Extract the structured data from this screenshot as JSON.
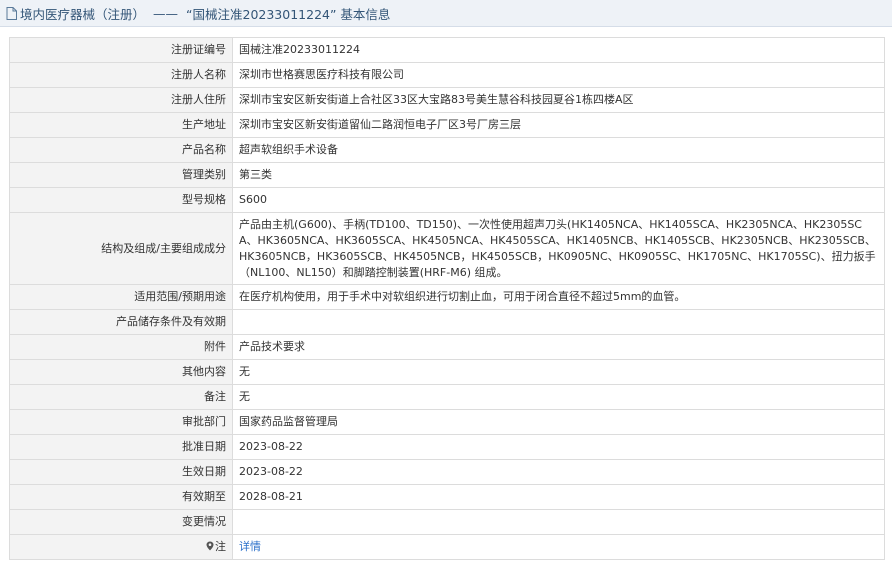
{
  "header": {
    "section": "境内医疗器械（注册）",
    "separator": "——",
    "title": "“国械注准20233011224” 基本信息"
  },
  "rows": [
    {
      "label": "注册证编号",
      "value": "国械注准20233011224"
    },
    {
      "label": "注册人名称",
      "value": "深圳市世格赛思医疗科技有限公司"
    },
    {
      "label": "注册人住所",
      "value": "深圳市宝安区新安街道上合社区33区大宝路83号美生慧谷科技园夏谷1栋四楼A区"
    },
    {
      "label": "生产地址",
      "value": "深圳市宝安区新安街道留仙二路润恒电子厂区3号厂房三层"
    },
    {
      "label": "产品名称",
      "value": "超声软组织手术设备"
    },
    {
      "label": "管理类别",
      "value": "第三类"
    },
    {
      "label": "型号规格",
      "value": "S600"
    },
    {
      "label": "结构及组成/主要组成成分",
      "value": "产品由主机(G600)、手柄(TD100、TD150)、一次性使用超声刀头(HK1405NCA、HK1405SCA、HK2305NCA、HK2305SCA、HK3605NCA、HK3605SCA、HK4505NCA、HK4505SCA、HK1405NCB、HK1405SCB、HK2305NCB、HK2305SCB、HK3605NCB，HK3605SCB、HK4505NCB，HK4505SCB，HK0905NC、HK0905SC、HK1705NC、HK1705SC)、扭力扳手（NL100、NL150）和脚踏控制装置(HRF-M6) 组成。"
    },
    {
      "label": "适用范围/预期用途",
      "value": "在医疗机构使用，用于手术中对软组织进行切割止血，可用于闭合直径不超过5mm的血管。"
    },
    {
      "label": "产品储存条件及有效期",
      "value": ""
    },
    {
      "label": "附件",
      "value": "产品技术要求"
    },
    {
      "label": "其他内容",
      "value": "无"
    },
    {
      "label": "备注",
      "value": "无"
    },
    {
      "label": "审批部门",
      "value": "国家药品监督管理局"
    },
    {
      "label": "批准日期",
      "value": "2023-08-22"
    },
    {
      "label": "生效日期",
      "value": "2023-08-22"
    },
    {
      "label": "有效期至",
      "value": "2028-08-21"
    },
    {
      "label": "变更情况",
      "value": ""
    }
  ],
  "note": {
    "label": "注",
    "link": "详情",
    "icon": "location-pin-icon"
  },
  "colors": {
    "header_bg": "#eef2f7",
    "label_bg": "#f3f3f3",
    "link": "#2a6fc9",
    "border": "#dcdcdc"
  }
}
